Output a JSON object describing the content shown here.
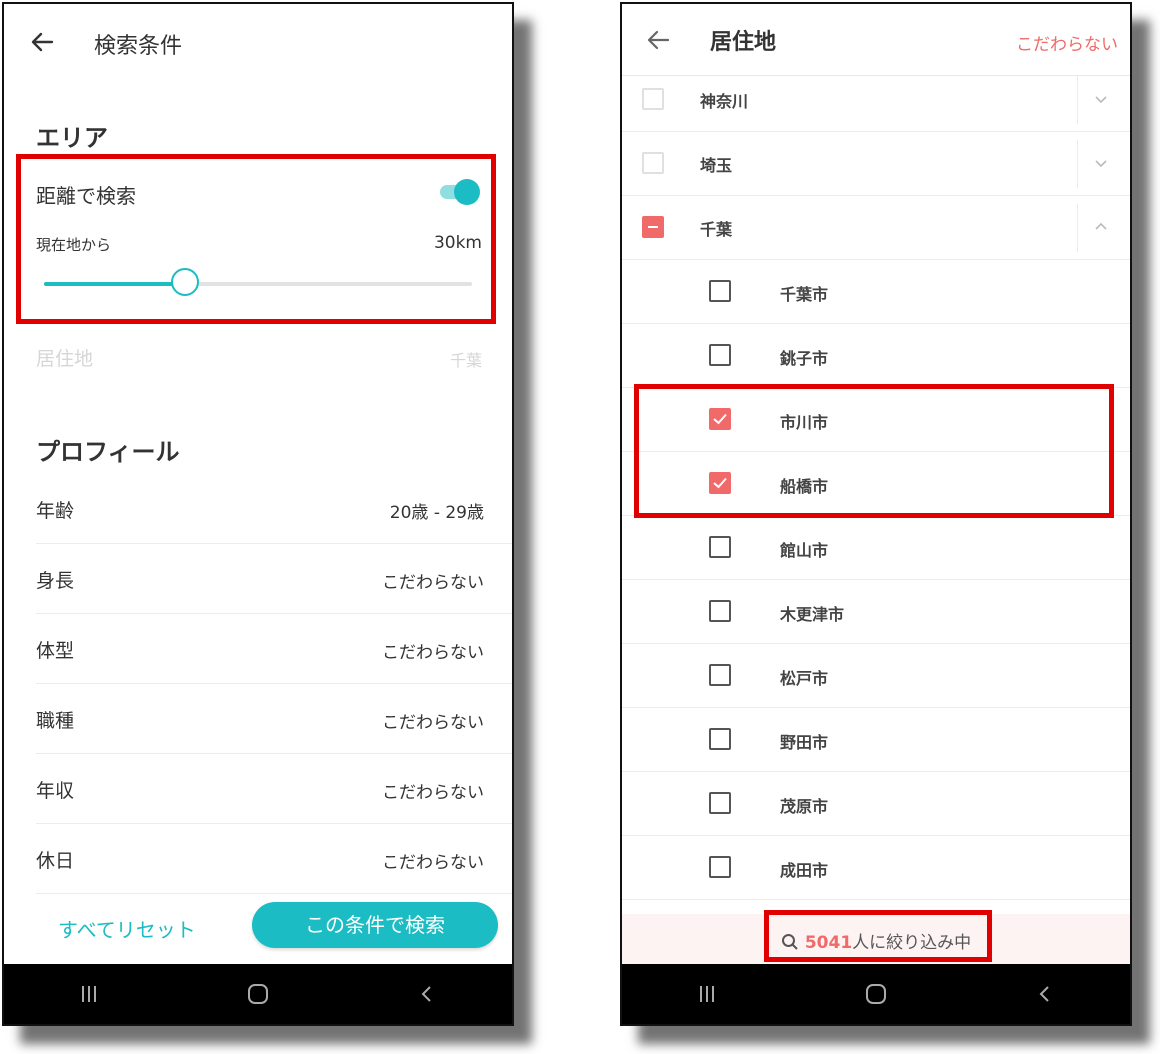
{
  "left": {
    "header_title": "検索条件",
    "area_title": "エリア",
    "distance_label": "距離で検索",
    "distance_toggle_on": true,
    "from_label": "現在地から",
    "distance_value": "30km",
    "slider_fraction": 0.33,
    "residence_label": "居住地",
    "residence_value": "千葉",
    "profile_title": "プロフィール",
    "profile_rows": [
      {
        "label": "年齢",
        "value": "20歳 - 29歳"
      },
      {
        "label": "身長",
        "value": "こだわらない"
      },
      {
        "label": "体型",
        "value": "こだわらない"
      },
      {
        "label": "職種",
        "value": "こだわらない"
      },
      {
        "label": "年収",
        "value": "こだわらない"
      },
      {
        "label": "休日",
        "value": "こだわらない"
      }
    ],
    "reset_label": "すべてリセット",
    "search_label": "この条件で検索"
  },
  "right": {
    "header_title": "居住地",
    "any_label": "こだわらない",
    "prefectures": [
      {
        "name": "神奈川",
        "state": "unchecked",
        "expanded": false
      },
      {
        "name": "埼玉",
        "state": "unchecked",
        "expanded": false
      },
      {
        "name": "千葉",
        "state": "partial",
        "expanded": true
      }
    ],
    "cities": [
      {
        "name": "千葉市",
        "checked": false
      },
      {
        "name": "銚子市",
        "checked": false
      },
      {
        "name": "市川市",
        "checked": true
      },
      {
        "name": "船橋市",
        "checked": true
      },
      {
        "name": "館山市",
        "checked": false
      },
      {
        "name": "木更津市",
        "checked": false
      },
      {
        "name": "松戸市",
        "checked": false
      },
      {
        "name": "野田市",
        "checked": false
      },
      {
        "name": "茂原市",
        "checked": false
      },
      {
        "name": "成田市",
        "checked": false
      }
    ],
    "result_count": "5041",
    "result_suffix": "人に絞り込み中"
  },
  "colors": {
    "teal": "#1bbcc3",
    "coral": "#f06a6a",
    "highlight": "#e00000"
  }
}
